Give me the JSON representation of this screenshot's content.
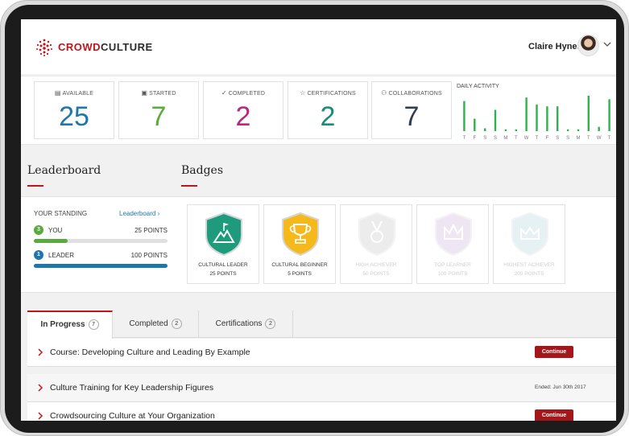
{
  "header": {
    "brand_part1": "CROWD",
    "brand_part2": "CULTURE",
    "user_name": "Claire Hynes"
  },
  "stats": [
    {
      "label": "AVAILABLE",
      "value": "25",
      "icon": "book-icon",
      "color": "#1f77a8"
    },
    {
      "label": "STARTED",
      "value": "7",
      "icon": "briefcase-icon",
      "color": "#5aaa3c"
    },
    {
      "label": "COMPLETED",
      "value": "2",
      "icon": "check-icon",
      "color": "#b5297f"
    },
    {
      "label": "CERTIFICATIONS",
      "value": "2",
      "icon": "star-icon",
      "color": "#198d7a"
    },
    {
      "label": "COLLABORATIONS",
      "value": "7",
      "icon": "people-icon",
      "color": "#2f3e4d"
    }
  ],
  "daily_activity": {
    "title": "DAILY ACTIVITY",
    "days": [
      "T",
      "F",
      "S",
      "S",
      "M",
      "T",
      "W",
      "T",
      "F",
      "S",
      "S",
      "M",
      "T",
      "W",
      "T"
    ],
    "values": [
      0.85,
      0.35,
      0.08,
      0.6,
      0.05,
      0.05,
      0.95,
      0.75,
      0.7,
      0.7,
      0.05,
      0.05,
      1.0,
      0.12,
      0.9
    ],
    "bar_color": "#2db34a"
  },
  "sections": {
    "leaderboard_title": "Leaderboard",
    "badges_title": "Badges"
  },
  "leaderboard": {
    "standing_label": "YOUR STANDING",
    "link_label": "Leaderboard",
    "you": {
      "rank": "3",
      "label": "YOU",
      "points": "25 POINTS",
      "progress": 0.25
    },
    "leader": {
      "rank": "1",
      "label": "LEADER",
      "points": "100 POINTS",
      "progress": 1.0
    }
  },
  "badges": [
    {
      "name": "CULTURAL LEADER",
      "points": "25 POINTS",
      "icon": "mountain-flag-icon",
      "locked": false,
      "color": "#1e9a7d"
    },
    {
      "name": "CULTURAL BEGINNER",
      "points": "5 POINTS",
      "icon": "trophy-icon",
      "locked": false,
      "color": "#f5b91c"
    },
    {
      "name": "HIGH ACHIEVER",
      "points": "50 POINTS",
      "icon": "medal-icon",
      "locked": true,
      "color": "#e2e2e2"
    },
    {
      "name": "TOP LEARNER",
      "points": "100 POINTS",
      "icon": "crown-icon",
      "locked": true,
      "color": "#efe6f3"
    },
    {
      "name": "HIGHEST ACHIEVER",
      "points": "200 POINTS",
      "icon": "crown-icon",
      "locked": true,
      "color": "#e6f1f4"
    }
  ],
  "tabs": [
    {
      "label": "In Progress",
      "count": "7",
      "active": true
    },
    {
      "label": "Completed",
      "count": "2",
      "active": false
    },
    {
      "label": "Certifications",
      "count": "2",
      "active": false
    }
  ],
  "courses": [
    {
      "title": "Course: Developing Culture and Leading By Example",
      "action": "Continue",
      "ended": ""
    },
    {
      "title": "Culture Training for Key Leadership Figures",
      "action": "",
      "ended": "Ended: Jun 30th 2017"
    },
    {
      "title": "Crowdsourcing Culture at Your Organization",
      "action": "Continue",
      "ended": ""
    }
  ]
}
